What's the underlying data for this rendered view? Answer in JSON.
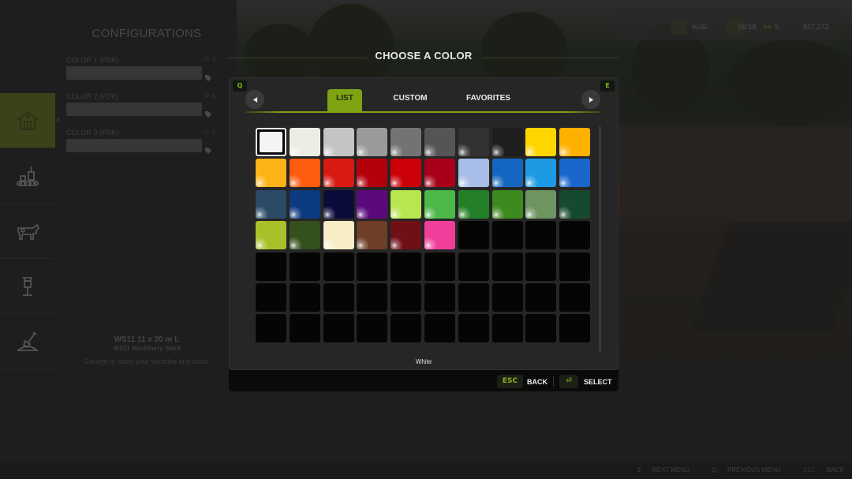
{
  "hud": {
    "month": "AUG",
    "time": "08:18",
    "speed": "5",
    "money": "827,272"
  },
  "configurations": {
    "title": "CONFIGURATIONS",
    "options": [
      {
        "label": "COLOR 1 (PDK)",
        "price": "-0 $"
      },
      {
        "label": "COLOR 2 (PDK)",
        "price": "-0 $"
      },
      {
        "label": "COLOR 3 (PDK)",
        "price": "-0 $"
      }
    ],
    "nav_items": [
      "buildings",
      "production",
      "animals",
      "decoration",
      "landscaping"
    ],
    "item_name": "WS11 11 x 20 m L",
    "item_subtitle": "WS11 Machinery Shed",
    "item_description": "Garage to store your vehicles and tools."
  },
  "dialog": {
    "title": "CHOOSE A COLOR",
    "prev_key": "Q",
    "next_key": "E",
    "tabs": [
      {
        "label": "LIST",
        "active": true
      },
      {
        "label": "CUSTOM",
        "active": false
      },
      {
        "label": "FAVORITES",
        "active": false
      }
    ],
    "selected_color_name": "White",
    "selected_index": 0,
    "grid_columns": 10,
    "grid_rows": 7,
    "colors": [
      "#f4f4f4",
      "#eceee4",
      "#c4c4c4",
      "#9a9a9a",
      "#737373",
      "#555555",
      "#333131",
      "#1e1e1e",
      "#ffd500",
      "#ffb000",
      "#fbb315",
      "#ff5c10",
      "#d91a12",
      "#b3000a",
      "#cc0008",
      "#a8001a",
      "#a8bde8",
      "#1466c0",
      "#1d9ae4",
      "#1a66cc",
      "#2b4a66",
      "#0c3a7e",
      "#0c0c3c",
      "#5c0a7a",
      "#b8e650",
      "#4cb848",
      "#238028",
      "#3d8a1e",
      "#6e9460",
      "#164a2e",
      "#a9c02a",
      "#34501c",
      "#f6ecc6",
      "#6e3e26",
      "#6e1016",
      "#ef3f9a"
    ],
    "footer": {
      "back_key": "ESC",
      "back_label": "BACK",
      "select_key": "⏎",
      "select_label": "SELECT"
    }
  },
  "bottom_bar": {
    "next_key": "E",
    "next_label": "NEXT MENU",
    "prev_key": "Q",
    "prev_label": "PREVIOUS MENU",
    "back_key": "ESC",
    "back_label": "BACK"
  }
}
